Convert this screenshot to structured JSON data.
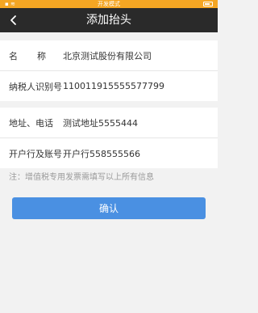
{
  "status_bar": {
    "left": "▪ ≋",
    "center": "开发模式",
    "battery_color": "#ffffff"
  },
  "header": {
    "title": "添加抬头",
    "back_icon": "chevron-left-icon"
  },
  "form": {
    "company_name": {
      "label": "名称",
      "value": "北京测试股份有限公司"
    },
    "taxpayer_id": {
      "label": "纳税人识别号",
      "value": "110011915555577799"
    },
    "address_phone": {
      "label": "地址、电话",
      "value": "测试地址5555444"
    },
    "bank_account": {
      "label": "开户行及账号",
      "value": "开户行558555566"
    }
  },
  "note": "注：增值税专用发票需填写以上所有信息",
  "confirm_label": "确认",
  "colors": {
    "status_bar": "#f5a623",
    "nav_bar": "#2a2a2a",
    "primary_button": "#4a90e2",
    "background": "#f2f2f2"
  }
}
